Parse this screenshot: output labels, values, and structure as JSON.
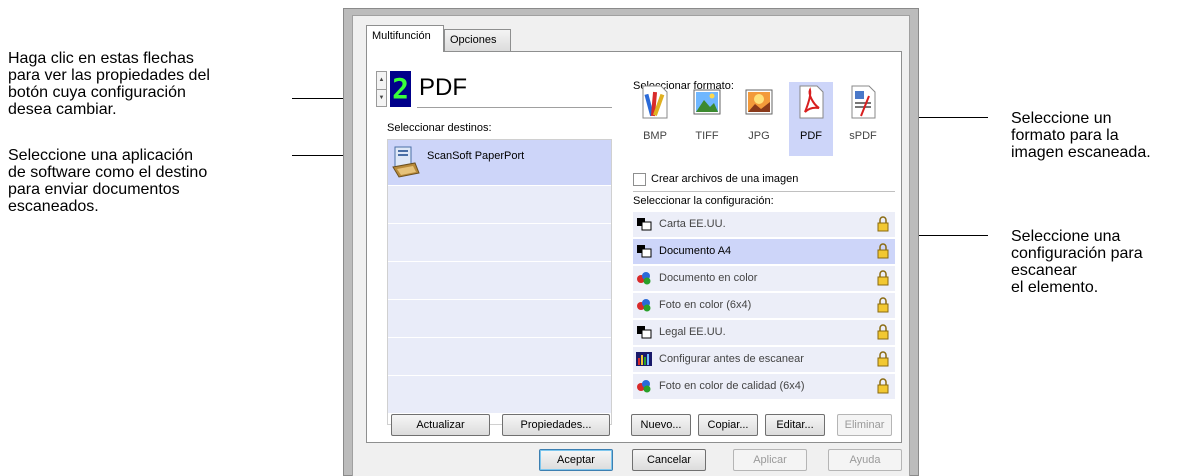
{
  "callouts": {
    "arrows": [
      "Haga clic en estas flechas",
      "para ver las propiedades del",
      "botón cuya configuración",
      "desea cambiar."
    ],
    "app": [
      "Seleccione una aplicación",
      "de software como el destino",
      "para enviar documentos",
      "escaneados."
    ],
    "format": [
      "Seleccione un",
      "formato para la",
      "imagen escaneada."
    ],
    "config": [
      "Seleccione una",
      "configuración para",
      "escanear",
      "el elemento."
    ]
  },
  "tabs": [
    "Multifunción",
    "Opciones"
  ],
  "button": {
    "number": "2",
    "name": "PDF"
  },
  "destinations": {
    "label": "Seleccionar destinos:",
    "selected": "ScanSoft PaperPort"
  },
  "formats": {
    "label": "Seleccionar formato:",
    "items": [
      "BMP",
      "TIFF",
      "JPG",
      "PDF",
      "sPDF"
    ],
    "selected": "PDF"
  },
  "single_image_checkbox": {
    "label": "Crear archivos de una imagen",
    "checked": false
  },
  "configurations": {
    "label": "Seleccionar la configuración:",
    "items": [
      "Carta EE.UU.",
      "Documento A4",
      "Documento en color",
      "Foto en color (6x4)",
      "Legal EE.UU.",
      "Configurar antes de escanear",
      "Foto en color de calidad (6x4)"
    ],
    "selected": "Documento A4"
  },
  "dest_buttons": {
    "update": "Actualizar",
    "properties": "Propiedades..."
  },
  "config_buttons": {
    "new": "Nuevo...",
    "copy": "Copiar...",
    "edit": "Editar...",
    "delete": "Eliminar"
  },
  "dialog_buttons": {
    "ok": "Aceptar",
    "cancel": "Cancelar",
    "apply": "Aplicar",
    "help": "Ayuda"
  },
  "colors": {
    "selection": "#cdd5f9",
    "row": "#eceef8",
    "lcd_bg": "#00008a",
    "lcd_fg": "#39ff39"
  }
}
